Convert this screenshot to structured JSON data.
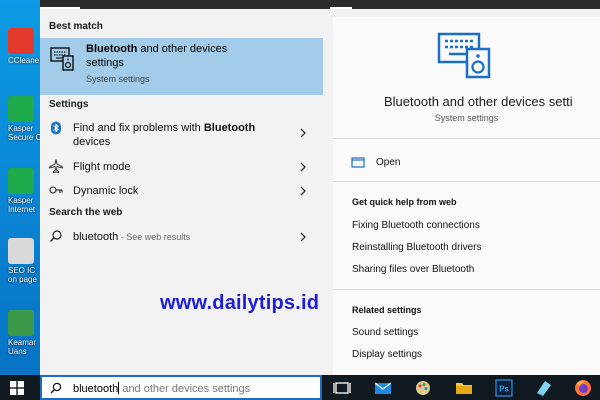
{
  "desktop": {
    "icons": [
      {
        "label": "CCleane"
      },
      {
        "label": "Kasper"
      },
      {
        "label": "Secure C"
      },
      {
        "label": "Kasper"
      },
      {
        "label": "Internet"
      },
      {
        "label": "SEO IC"
      },
      {
        "label": "on page"
      },
      {
        "label": "Keamar"
      },
      {
        "label": "Uans"
      }
    ]
  },
  "left": {
    "best_match_header": "Best match",
    "best_match": {
      "title_bold": "Bluetooth",
      "title_rest": " and other devices",
      "title_line2": "settings",
      "subtitle": "System settings"
    },
    "settings_header": "Settings",
    "settings_items": [
      {
        "pre": "Find and fix problems with ",
        "bold": "Bluetooth",
        "line2": "devices"
      },
      {
        "label": "Flight mode"
      },
      {
        "label": "Dynamic lock"
      }
    ],
    "web_header": "Search the web",
    "web_item": {
      "query": "bluetooth",
      "suffix": " - See web results"
    }
  },
  "right": {
    "title": "Bluetooth and other devices setti",
    "subtitle": "System settings",
    "open_label": "Open",
    "help_header": "Get quick help from web",
    "help_links": [
      "Fixing Bluetooth connections",
      "Reinstalling Bluetooth drivers",
      "Sharing files over Bluetooth"
    ],
    "related_header": "Related settings",
    "related_links": [
      "Sound settings",
      "Display settings"
    ]
  },
  "watermark": "www.dailytips.id",
  "search": {
    "typed": "bluetooth",
    "completion": " and other devices settings"
  },
  "colors": {
    "highlight": "#a2cce9",
    "accent": "#1a6fc4",
    "watermark": "#1d1ddc",
    "taskbar": "#101820"
  }
}
